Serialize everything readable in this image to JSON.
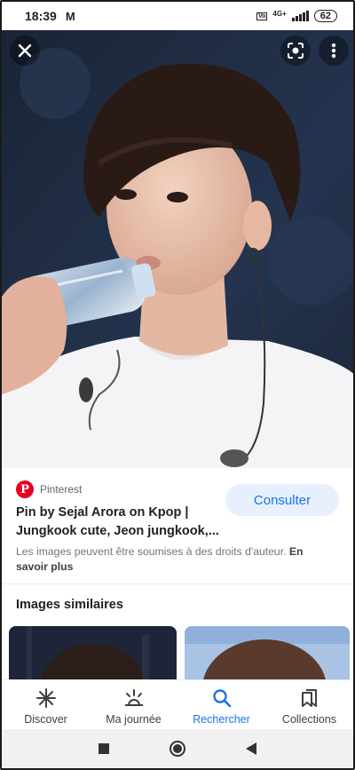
{
  "status_bar": {
    "time": "18:39",
    "mail_icon": "gmail-icon",
    "network": "4G+",
    "battery": "62"
  },
  "viewer": {
    "close_icon": "close-icon",
    "lens_icon": "lens-search-icon",
    "menu_icon": "more-vert-icon"
  },
  "result": {
    "source": "Pinterest",
    "title": "Pin by Sejal Arora on Kpop | Jungkook cute, Jeon jungkook,...",
    "consult_label": "Consulter",
    "notice_text": "Les images peuvent être soumises à des droits d'auteur.",
    "notice_link": "En savoir plus"
  },
  "similar": {
    "title": "Images similaires"
  },
  "bottom_nav": {
    "items": [
      {
        "label": "Discover",
        "icon": "asterisk-icon"
      },
      {
        "label": "Ma journée",
        "icon": "sunrise-icon"
      },
      {
        "label": "Rechercher",
        "icon": "search-icon"
      },
      {
        "label": "Collections",
        "icon": "bookmarks-icon"
      }
    ],
    "active_index": 2
  },
  "colors": {
    "accent": "#1a73e8",
    "pinterest_red": "#e60023",
    "consult_bg": "#e8f0fe"
  }
}
